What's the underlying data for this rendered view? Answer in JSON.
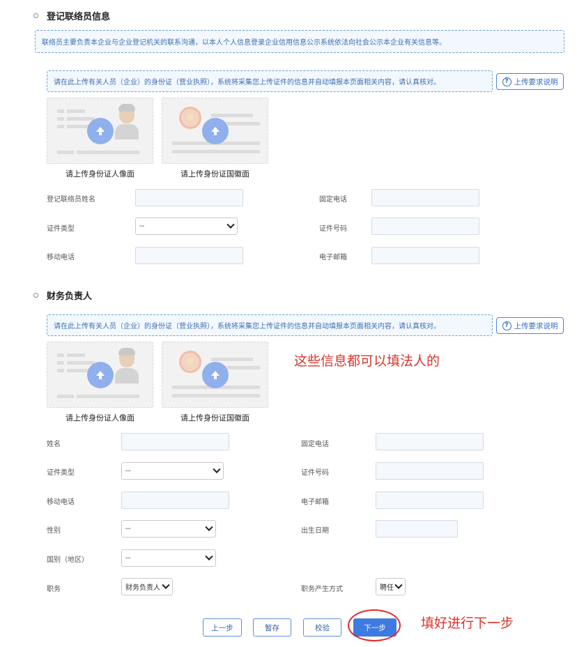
{
  "section1": {
    "title": "登记联络员信息",
    "notice": "联络员主要负责本企业与企业登记机关的联系沟通，以本人个人信息登录企业信用信息公示系统依法向社会公示本企业有关信息等。",
    "upload_notice": "请在此上传有关人员（企业）的身份证（营业执照），系统将采集您上传证件的信息并自动填报本页面相关内容，请认真核对。",
    "req_btn": "上传要求说明",
    "upload_front": "请上传身份证人像面",
    "upload_back": "请上传身份证国徽面",
    "fields": {
      "name": "登记联络员姓名",
      "phone": "固定电话",
      "id_type": "证件类型",
      "id_type_value": "--",
      "id_no": "证件号码",
      "mobile": "移动电话",
      "email": "电子邮箱"
    }
  },
  "section2": {
    "title": "财务负责人",
    "upload_notice": "请在此上传有关人员（企业）的身份证（营业执照），系统将采集您上传证件的信息并自动填报本页面相关内容，请认真核对。",
    "req_btn": "上传要求说明",
    "upload_front": "请上传身份证人像面",
    "upload_back": "请上传身份证国徽面",
    "fields": {
      "name": "姓名",
      "phone": "固定电话",
      "id_type": "证件类型",
      "id_type_value": "--",
      "id_no": "证件号码",
      "mobile": "移动电话",
      "email": "电子邮箱",
      "gender": "性别",
      "gender_value": "--",
      "birth": "出生日期",
      "country": "国别（地区）",
      "country_value": "--",
      "position": "职务",
      "position_value": "财务负责人",
      "position_method": "职务产生方式",
      "position_method_value": "聘任"
    }
  },
  "buttons": {
    "prev": "上一步",
    "save": "暂存",
    "verify": "校验",
    "next": "下一步"
  },
  "annotations": {
    "note1": "这些信息都可以填法人的",
    "note2": "填好进行下一步"
  },
  "colors": {
    "annotation": "#d9342b",
    "primary": "#3d7be0",
    "notice_text": "#3d6fb0"
  },
  "icons": {
    "upload": "upload-arrow-icon",
    "help": "question-circle-icon",
    "dropdown": "chevron-down-icon"
  }
}
